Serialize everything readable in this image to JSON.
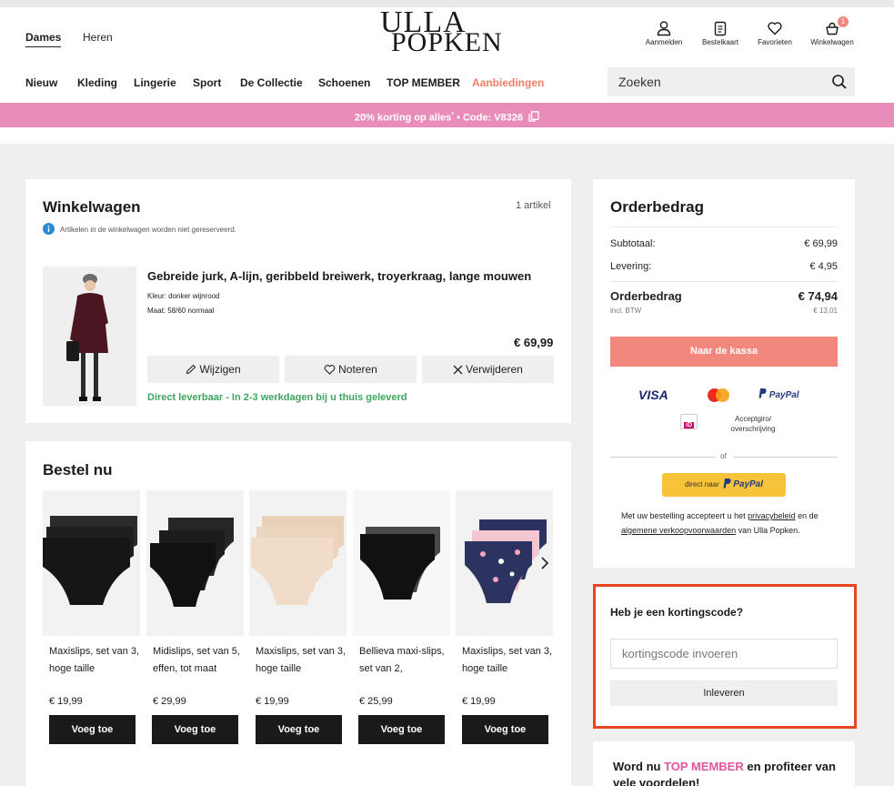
{
  "header": {
    "genders": [
      "Dames",
      "Heren"
    ],
    "logo_line1": "ULLA",
    "logo_line2": "POPKEN",
    "icons": [
      {
        "icon": "user-icon",
        "label": "Aanmelden"
      },
      {
        "icon": "order-card-icon",
        "label": "Bestelkaart"
      },
      {
        "icon": "heart-icon",
        "label": "Favorieten"
      },
      {
        "icon": "basket-icon",
        "label": "Winkelwagen",
        "badge": "1"
      }
    ],
    "nav": [
      "Nieuw",
      "Kleding",
      "Lingerie",
      "Sport",
      "De Collectie",
      "Schoenen",
      "TOP MEMBER",
      "Aanbiedingen"
    ],
    "search_placeholder": "Zoeken"
  },
  "promo": {
    "text": "20% korting op alles",
    "sup": "*",
    "code": " • Code: V8326",
    "color": "#e88dba"
  },
  "cart": {
    "title": "Winkelwagen",
    "count": "1 artikel",
    "notice": "Artikelen in de winkelwagen worden niet gereserveerd.",
    "item": {
      "name": "Gebreide jurk, A-lijn, geribbeld breiwerk, troyerkraag, lange mouwen",
      "color": "Kleur: donker wijnrood",
      "size": "Maat: 58/60 normaal",
      "price": "€ 69,99",
      "actions": [
        "Wijzigen",
        "Noteren",
        "Verwijderen"
      ],
      "delivery": "Direct leverbaar - In 2-3 werkdagen bij u thuis geleverd"
    }
  },
  "bestel": {
    "title": "Bestel nu",
    "products": [
      {
        "name": "Maxislips, set van 3, hoge taille",
        "price": "€ 19,99"
      },
      {
        "name": "Midislips, set van 5, effen, tot maat",
        "price": "€ 29,99"
      },
      {
        "name": "Maxislips, set van 3, hoge taille",
        "price": "€ 19,99"
      },
      {
        "name": "Bellieva maxi-slips, set van 2,",
        "price": "€ 25,99"
      },
      {
        "name": "Maxislips, set van 3, hoge taille",
        "price": "€ 19,99"
      }
    ],
    "add_label": "Voeg toe"
  },
  "order": {
    "title": "Orderbedrag",
    "subtotal_label": "Subtotaal:",
    "subtotal": "€ 69,99",
    "delivery_label": "Levering:",
    "delivery": "€ 4,95",
    "total_label": "Orderbedrag",
    "total": "€ 74,94",
    "vat_label": "incl. BTW",
    "vat": "€ 13,01",
    "checkout": "Naar de kassa",
    "payments": {
      "visa": "VISA",
      "paypal": "PayPal",
      "ideal": "iD",
      "accept": "Acceptgiro/ overschrijving"
    },
    "or": "of",
    "paypal_direct_prefix": "direct naar",
    "paypal_direct_brand": "PayPal",
    "legal": {
      "t1": "Met uw bestelling accepteert u het ",
      "link1": "privacybeleid",
      "t2": " en de ",
      "link2": "algemene verkoopvoorwaarden",
      "t3": " van Ulla Popken."
    }
  },
  "discount": {
    "title": "Heb je een kortingscode?",
    "placeholder": "kortingscode invoeren",
    "submit": "Inleveren",
    "highlight_color": "#e8461e"
  },
  "member": {
    "t1": "Word nu ",
    "highlight": "TOP MEMBER",
    "t2": " en profiteer van",
    "t3": "vele voordelen!"
  }
}
